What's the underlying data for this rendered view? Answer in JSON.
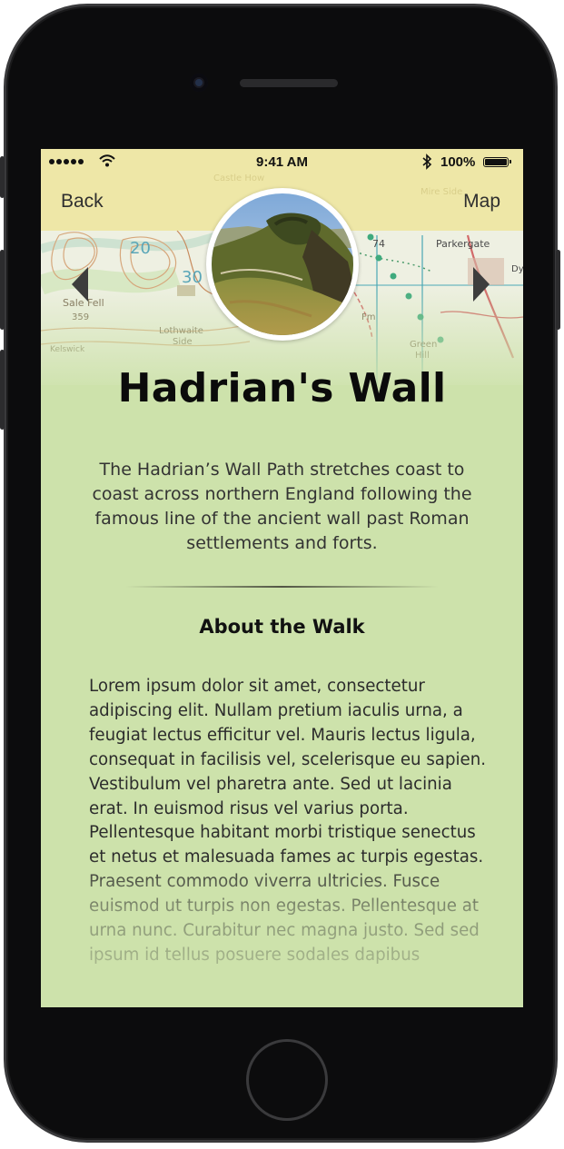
{
  "status_bar": {
    "time": "9:41 AM",
    "battery_percent": "100%",
    "signal_icon": "signal-dots-icon",
    "wifi_icon": "wifi-icon",
    "bluetooth_icon": "bluetooth-icon",
    "battery_icon": "battery-icon"
  },
  "navigation": {
    "back_label": "Back",
    "map_label": "Map",
    "prev_icon": "triangle-left-icon",
    "next_icon": "triangle-right-icon"
  },
  "map_labels": [
    "Castle How",
    "Mire Side",
    "Sale Fell",
    "359",
    "Lothwaite",
    "Side",
    "Kelswick",
    "20",
    "30",
    "74",
    "Parkergate",
    "Green",
    "Hill",
    "Fm",
    "Dy"
  ],
  "walk": {
    "title": "Hadrian's Wall",
    "intro": "The Hadrian’s Wall Path stretches coast to coast across northern England following the famous line of the ancient wall past Roman settlements and forts.",
    "section_title": "About the Walk",
    "body": "Lorem ipsum dolor sit amet, consectetur adipiscing elit. Nullam pretium iaculis urna, a feugiat lectus efficitur vel. Mauris lectus ligula, consequat in facilisis vel, scelerisque eu sapien. Vestibulum vel pharetra ante. Sed ut lacinia erat. In euismod risus vel varius porta. Pellentesque habitant morbi tristique senectus et netus et malesuada fames ac turpis egestas. Praesent commodo viverra ultricies. Fusce euismod ut turpis non egestas. Pellentesque at urna nunc. Curabitur nec magna justo. Sed sed ipsum id tellus posuere sodales dapibus"
  },
  "colors": {
    "screen_background": "#cde2ab",
    "nav_band": "#eee496",
    "title_text": "#0b0b0b"
  }
}
